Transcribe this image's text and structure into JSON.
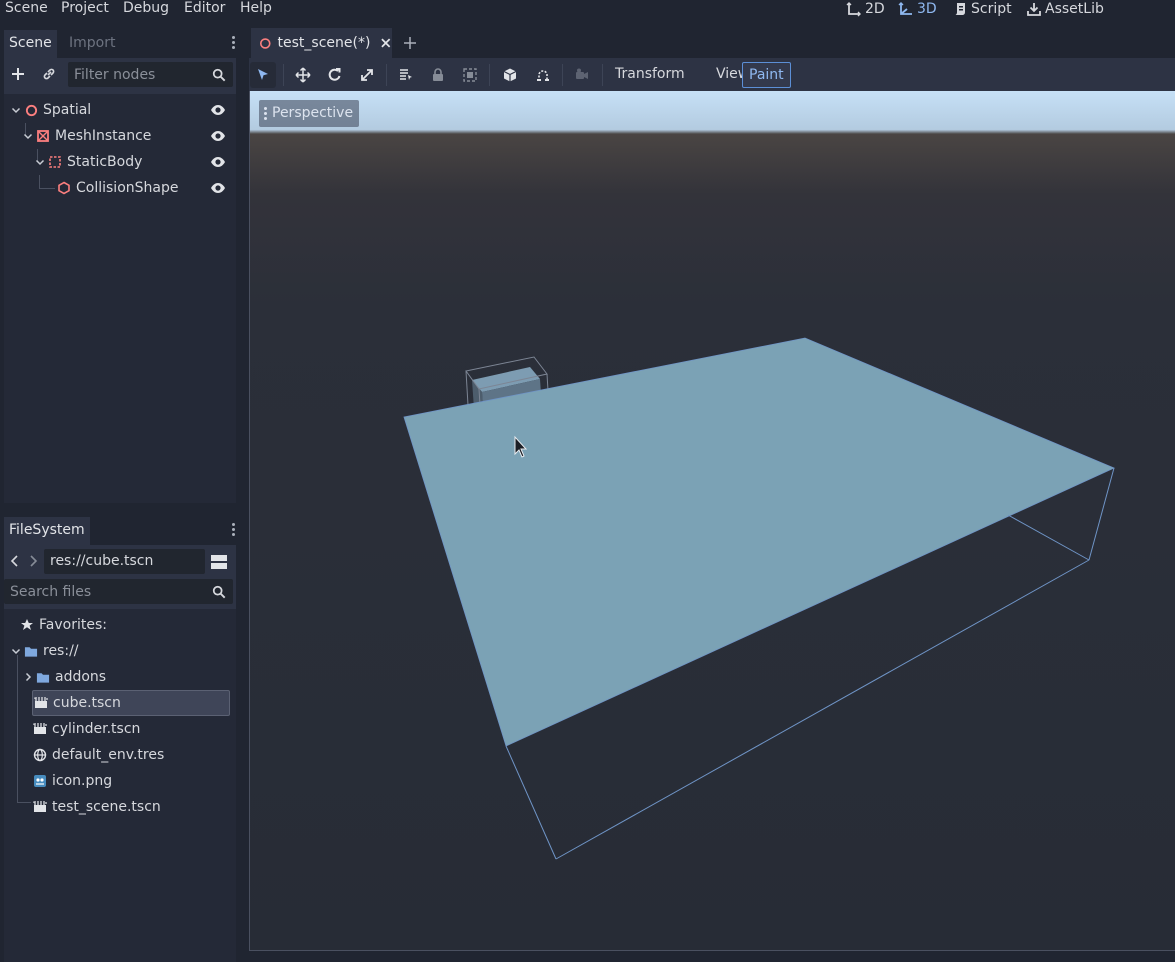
{
  "menubar": {
    "items": [
      "Scene",
      "Project",
      "Debug",
      "Editor",
      "Help"
    ],
    "modes": [
      {
        "label": "2D",
        "icon": "2d-icon",
        "active": false
      },
      {
        "label": "3D",
        "icon": "3d-icon",
        "active": true
      },
      {
        "label": "Script",
        "icon": "script-icon",
        "active": false
      },
      {
        "label": "AssetLib",
        "icon": "assetlib-icon",
        "active": false
      }
    ]
  },
  "scene_dock": {
    "tabs": [
      "Scene",
      "Import"
    ],
    "filter_placeholder": "Filter nodes",
    "nodes": [
      {
        "label": "Spatial",
        "icon": "spatial-icon",
        "visible": true
      },
      {
        "label": "MeshInstance",
        "icon": "mesh-instance-icon",
        "visible": true
      },
      {
        "label": "StaticBody",
        "icon": "static-body-icon",
        "visible": true
      },
      {
        "label": "CollisionShape",
        "icon": "collision-shape-icon",
        "visible": true
      }
    ]
  },
  "filesystem_dock": {
    "tab": "FileSystem",
    "path": "res://cube.tscn",
    "search_placeholder": "Search files",
    "favorites_label": "Favorites:",
    "root_label": "res://",
    "entries": [
      {
        "label": "addons",
        "icon": "folder-icon"
      },
      {
        "label": "cube.tscn",
        "icon": "scene-file-icon",
        "selected": true
      },
      {
        "label": "cylinder.tscn",
        "icon": "scene-file-icon"
      },
      {
        "label": "default_env.tres",
        "icon": "environment-icon"
      },
      {
        "label": "icon.png",
        "icon": "image-icon"
      },
      {
        "label": "test_scene.tscn",
        "icon": "scene-file-icon"
      }
    ]
  },
  "editor": {
    "scene_tab": "test_scene(*)",
    "toolbar_menus": [
      "Transform",
      "View",
      "Paint"
    ],
    "active_menu": "Paint",
    "viewport_label": "Perspective"
  },
  "colors": {
    "accent": "#8fb8f0",
    "plane": "#7ba2b5",
    "sky_top": "#c4def3",
    "ground": "#2a2f3a"
  }
}
